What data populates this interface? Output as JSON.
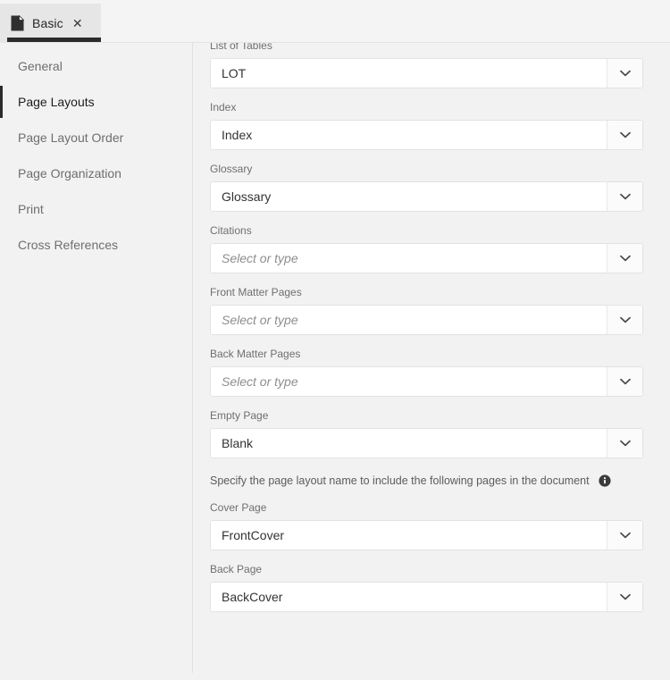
{
  "window": {
    "tab": {
      "label": "Basic",
      "icon": "document-icon",
      "close_label": "✕"
    }
  },
  "sidebar": {
    "items": [
      {
        "label": "General",
        "active": false
      },
      {
        "label": "Page Layouts",
        "active": true
      },
      {
        "label": "Page Layout Order",
        "active": false
      },
      {
        "label": "Page Organization",
        "active": false
      },
      {
        "label": "Print",
        "active": false
      },
      {
        "label": "Cross References",
        "active": false
      }
    ]
  },
  "main": {
    "placeholder": "Select or type",
    "caret_icon": "chevron-down-icon",
    "fields": [
      {
        "label": "List of Tables",
        "value": "LOT",
        "is_placeholder": false
      },
      {
        "label": "Index",
        "value": "Index",
        "is_placeholder": false
      },
      {
        "label": "Glossary",
        "value": "Glossary",
        "is_placeholder": false
      },
      {
        "label": "Citations",
        "value": "Select or type",
        "is_placeholder": true
      },
      {
        "label": "Front Matter Pages",
        "value": "Select or type",
        "is_placeholder": true
      },
      {
        "label": "Back Matter Pages",
        "value": "Select or type",
        "is_placeholder": true
      },
      {
        "label": "Empty Page",
        "value": "Blank",
        "is_placeholder": false
      }
    ],
    "hint": {
      "text": "Specify the page layout name to include the following pages in the document",
      "icon": "info-icon"
    },
    "fields_after_hint": [
      {
        "label": "Cover Page",
        "value": "FrontCover",
        "is_placeholder": false
      },
      {
        "label": "Back Page",
        "value": "BackCover",
        "is_placeholder": false
      }
    ]
  },
  "colors": {
    "background": "#f2f2f2",
    "tab_active": "#e6e6e6",
    "accent_dark": "#2b2b2b",
    "field_background": "#ffffff",
    "text_primary": "#333333",
    "text_muted": "#6f6f6f"
  }
}
